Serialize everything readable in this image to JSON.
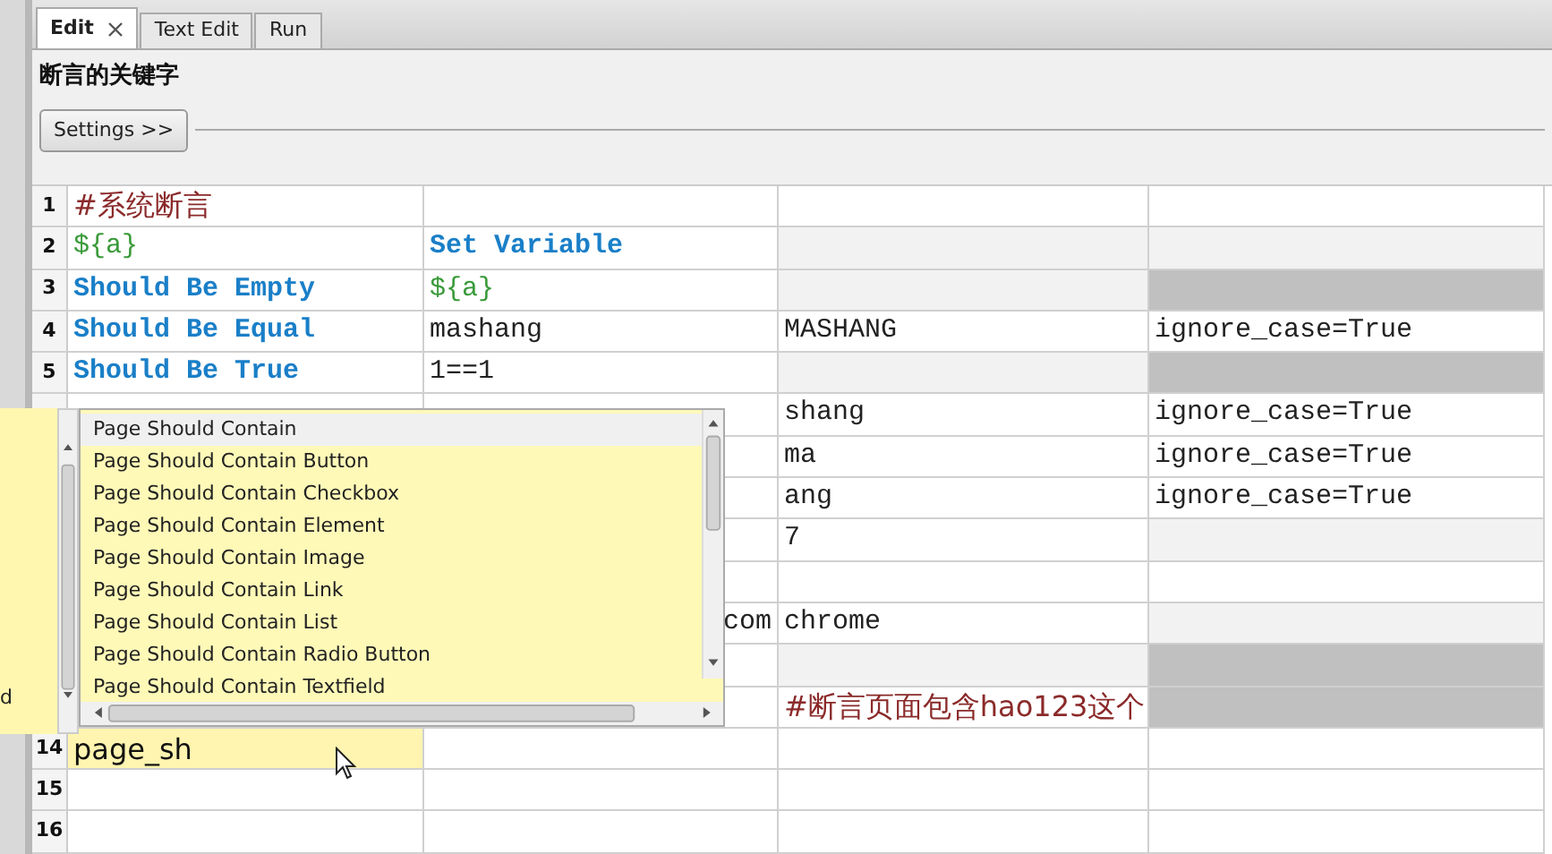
{
  "tabs": [
    {
      "label": "Edit",
      "selected": true,
      "closable": true
    },
    {
      "label": "Text Edit",
      "selected": false,
      "closable": false
    },
    {
      "label": "Run",
      "selected": false,
      "closable": false
    }
  ],
  "editor": {
    "title": "断言的关键字",
    "settings_button": "Settings >>"
  },
  "grid": {
    "rows": [
      {
        "number": "1",
        "cells": [
          {
            "text": "#系统断言",
            "kind": "comment"
          },
          {
            "kind": "empty"
          },
          {
            "kind": "empty"
          },
          {
            "kind": "empty"
          }
        ]
      },
      {
        "number": "2",
        "cells": [
          {
            "text": "${a}",
            "kind": "variable"
          },
          {
            "text": "Set Variable",
            "kind": "keyword"
          },
          {
            "kind": "unused"
          },
          {
            "kind": "unused"
          }
        ]
      },
      {
        "number": "3",
        "cells": [
          {
            "text": "Should Be Empty",
            "kind": "keyword"
          },
          {
            "text": "${a}",
            "kind": "variable"
          },
          {
            "kind": "unused"
          },
          {
            "kind": "blocked"
          }
        ]
      },
      {
        "number": "4",
        "cells": [
          {
            "text": "Should Be Equal",
            "kind": "keyword"
          },
          {
            "text": "mashang",
            "kind": "argument"
          },
          {
            "text": "MASHANG",
            "kind": "argument"
          },
          {
            "text": "ignore_case=True",
            "kind": "argument"
          }
        ]
      },
      {
        "number": "5",
        "cells": [
          {
            "text": "Should Be True",
            "kind": "keyword"
          },
          {
            "text": "1==1",
            "kind": "argument"
          },
          {
            "kind": "unused"
          },
          {
            "kind": "blocked"
          }
        ]
      },
      {
        "cells": [
          {
            "kind": "empty"
          },
          {
            "kind": "empty"
          },
          {
            "text": "shang",
            "kind": "argument"
          },
          {
            "text": "ignore_case=True",
            "kind": "argument"
          }
        ]
      },
      {
        "cells": [
          {
            "kind": "empty"
          },
          {
            "kind": "empty"
          },
          {
            "text": "ma",
            "kind": "argument"
          },
          {
            "text": "ignore_case=True",
            "kind": "argument"
          }
        ]
      },
      {
        "cells": [
          {
            "kind": "empty"
          },
          {
            "kind": "empty"
          },
          {
            "text": "ang",
            "kind": "argument"
          },
          {
            "text": "ignore_case=True",
            "kind": "argument"
          }
        ]
      },
      {
        "cells": [
          {
            "kind": "empty"
          },
          {
            "kind": "empty"
          },
          {
            "text": "7",
            "kind": "argument"
          },
          {
            "kind": "unused"
          }
        ]
      },
      {
        "cells": [
          {
            "kind": "empty"
          },
          {
            "kind": "empty"
          },
          {
            "kind": "empty"
          },
          {
            "kind": "empty"
          }
        ]
      },
      {
        "cells": [
          {
            "kind": "empty"
          },
          {
            "text": "com",
            "kind": "tail"
          },
          {
            "text": "chrome",
            "kind": "argument"
          },
          {
            "kind": "unused"
          }
        ]
      },
      {
        "cells": [
          {
            "kind": "empty"
          },
          {
            "kind": "empty"
          },
          {
            "kind": "unused"
          },
          {
            "kind": "blocked"
          }
        ]
      },
      {
        "cells": [
          {
            "kind": "empty"
          },
          {
            "kind": "empty"
          },
          {
            "text": "#断言页面包含hao123这个",
            "kind": "comment"
          },
          {
            "kind": "blocked"
          }
        ]
      },
      {
        "number": "14",
        "cells": [
          {
            "text": "page_sh",
            "kind": "editing"
          },
          {
            "kind": "empty"
          },
          {
            "kind": "empty"
          },
          {
            "kind": "empty"
          }
        ]
      },
      {
        "number": "15",
        "cells": [
          {
            "kind": "empty"
          },
          {
            "kind": "empty"
          },
          {
            "kind": "empty"
          },
          {
            "kind": "empty"
          }
        ]
      },
      {
        "number": "16",
        "cells": [
          {
            "kind": "empty"
          },
          {
            "kind": "empty"
          },
          {
            "kind": "empty"
          },
          {
            "kind": "empty"
          }
        ]
      }
    ]
  },
  "autocomplete": {
    "items": [
      {
        "label": "Page Should Contain",
        "selected": true
      },
      {
        "label": "Page Should Contain Button",
        "selected": false
      },
      {
        "label": "Page Should Contain Checkbox",
        "selected": false
      },
      {
        "label": "Page Should Contain Element",
        "selected": false
      },
      {
        "label": "Page Should Contain Image",
        "selected": false
      },
      {
        "label": "Page Should Contain Link",
        "selected": false
      },
      {
        "label": "Page Should Contain List",
        "selected": false
      },
      {
        "label": "Page Should Contain Radio Button",
        "selected": false
      },
      {
        "label": "Page Should Contain Textfield",
        "selected": false
      }
    ],
    "doc_tip": "d"
  }
}
